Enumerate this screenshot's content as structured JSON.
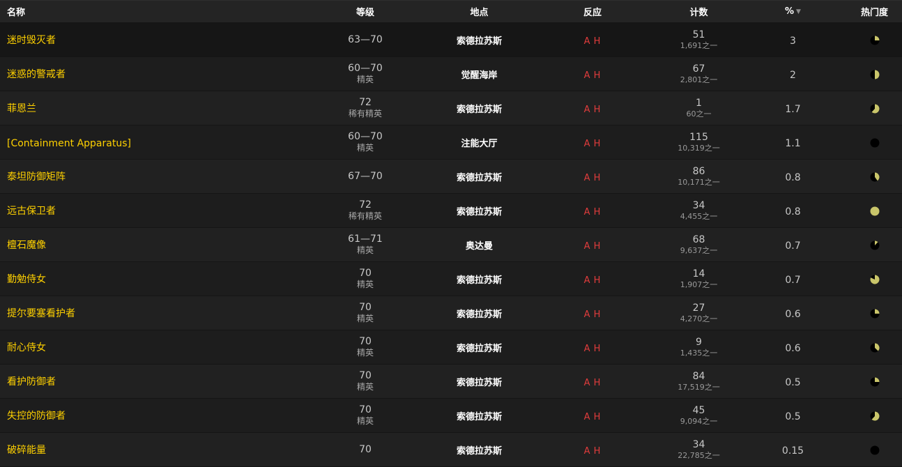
{
  "columns": {
    "name": "名称",
    "level": "等级",
    "location": "地点",
    "react": "反应",
    "count": "计数",
    "pct": "%",
    "popularity": "热门度"
  },
  "colors": {
    "name_link": "#ffd100",
    "hostile": "#e03c3c",
    "pie_fill": "#c9c56a",
    "pie_bg": "#000000"
  },
  "rows": [
    {
      "name": "迷时毁灭者",
      "level": "63—70",
      "level_sub": "",
      "location": "索德拉苏斯",
      "react": [
        "A",
        "H"
      ],
      "count": "51",
      "count_sub": "1,691之一",
      "pct": "3",
      "pop": 0.25
    },
    {
      "name": "迷惑的警戒者",
      "level": "60—70",
      "level_sub": "精英",
      "location": "觉醒海岸",
      "react": [
        "A",
        "H"
      ],
      "count": "67",
      "count_sub": "2,801之一",
      "pct": "2",
      "pop": 0.5
    },
    {
      "name": "菲恩兰",
      "level": "72",
      "level_sub": "稀有精英",
      "location": "索德拉苏斯",
      "react": [
        "A",
        "H"
      ],
      "count": "1",
      "count_sub": "60之一",
      "pct": "1.7",
      "pop": 0.62
    },
    {
      "name": "[Containment Apparatus]",
      "level": "60—70",
      "level_sub": "精英",
      "location": "注能大厅",
      "react": [
        "A",
        "H"
      ],
      "count": "115",
      "count_sub": "10,319之一",
      "pct": "1.1",
      "pop": 0.0
    },
    {
      "name": "泰坦防御矩阵",
      "level": "67—70",
      "level_sub": "",
      "location": "索德拉苏斯",
      "react": [
        "A",
        "H"
      ],
      "count": "86",
      "count_sub": "10,171之一",
      "pct": "0.8",
      "pop": 0.4
    },
    {
      "name": "远古保卫者",
      "level": "72",
      "level_sub": "稀有精英",
      "location": "索德拉苏斯",
      "react": [
        "A",
        "H"
      ],
      "count": "34",
      "count_sub": "4,455之一",
      "pct": "0.8",
      "pop": 1.0
    },
    {
      "name": "檀石魔像",
      "level": "61—71",
      "level_sub": "精英",
      "location": "奥达曼",
      "react": [
        "A",
        "H"
      ],
      "count": "68",
      "count_sub": "9,637之一",
      "pct": "0.7",
      "pop": 0.12
    },
    {
      "name": "勤勉侍女",
      "level": "70",
      "level_sub": "精英",
      "location": "索德拉苏斯",
      "react": [
        "A",
        "H"
      ],
      "count": "14",
      "count_sub": "1,907之一",
      "pct": "0.7",
      "pop": 0.82
    },
    {
      "name": "提尔要塞看护者",
      "level": "70",
      "level_sub": "精英",
      "location": "索德拉苏斯",
      "react": [
        "A",
        "H"
      ],
      "count": "27",
      "count_sub": "4,270之一",
      "pct": "0.6",
      "pop": 0.25
    },
    {
      "name": "耐心侍女",
      "level": "70",
      "level_sub": "精英",
      "location": "索德拉苏斯",
      "react": [
        "A",
        "H"
      ],
      "count": "9",
      "count_sub": "1,435之一",
      "pct": "0.6",
      "pop": 0.37
    },
    {
      "name": "看护防御者",
      "level": "70",
      "level_sub": "精英",
      "location": "索德拉苏斯",
      "react": [
        "A",
        "H"
      ],
      "count": "84",
      "count_sub": "17,519之一",
      "pct": "0.5",
      "pop": 0.25
    },
    {
      "name": "失控的防御者",
      "level": "70",
      "level_sub": "精英",
      "location": "索德拉苏斯",
      "react": [
        "A",
        "H"
      ],
      "count": "45",
      "count_sub": "9,094之一",
      "pct": "0.5",
      "pop": 0.62
    },
    {
      "name": "破碎能量",
      "level": "70",
      "level_sub": "",
      "location": "索德拉苏斯",
      "react": [
        "A",
        "H"
      ],
      "count": "34",
      "count_sub": "22,785之一",
      "pct": "0.15",
      "pop": 0.0
    }
  ]
}
